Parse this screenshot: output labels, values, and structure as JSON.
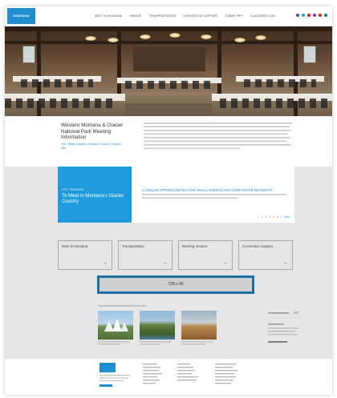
{
  "nav": {
    "items": [
      "MEET IN MONTANA",
      "VENUES",
      "TRANSPORTATION",
      "CONVENTION SUPPORT",
      "SUBMIT RFP",
      "GLACIERMT.COM"
    ]
  },
  "intro": {
    "title": "Western Montana & Glacier National Park Meeting Information",
    "subtitle": "The Official Western Montana Travel & Tourism Site"
  },
  "feature": {
    "kicker": "TOP 7 REASONS",
    "title": "To Meet in Montana's Glacier Country",
    "headline": "A UNIQUE OPPORTUNITIES FOR SMALL EVENTS AND CORPORATE RETREATS",
    "pager": [
      "1",
      "2",
      "3",
      "4",
      "5",
      "6",
      "7"
    ],
    "next": "Next"
  },
  "tiles": [
    {
      "label": "Meet in Montana"
    },
    {
      "label": "Transportation"
    },
    {
      "label": "Meeting Venues"
    },
    {
      "label": "Convention Support"
    }
  ],
  "ad": {
    "label": "728 x 90"
  },
  "colors": {
    "accent": "#1f8fd2",
    "feature_blue": "#1f9bdb",
    "ad_border": "#1c6fa6"
  }
}
